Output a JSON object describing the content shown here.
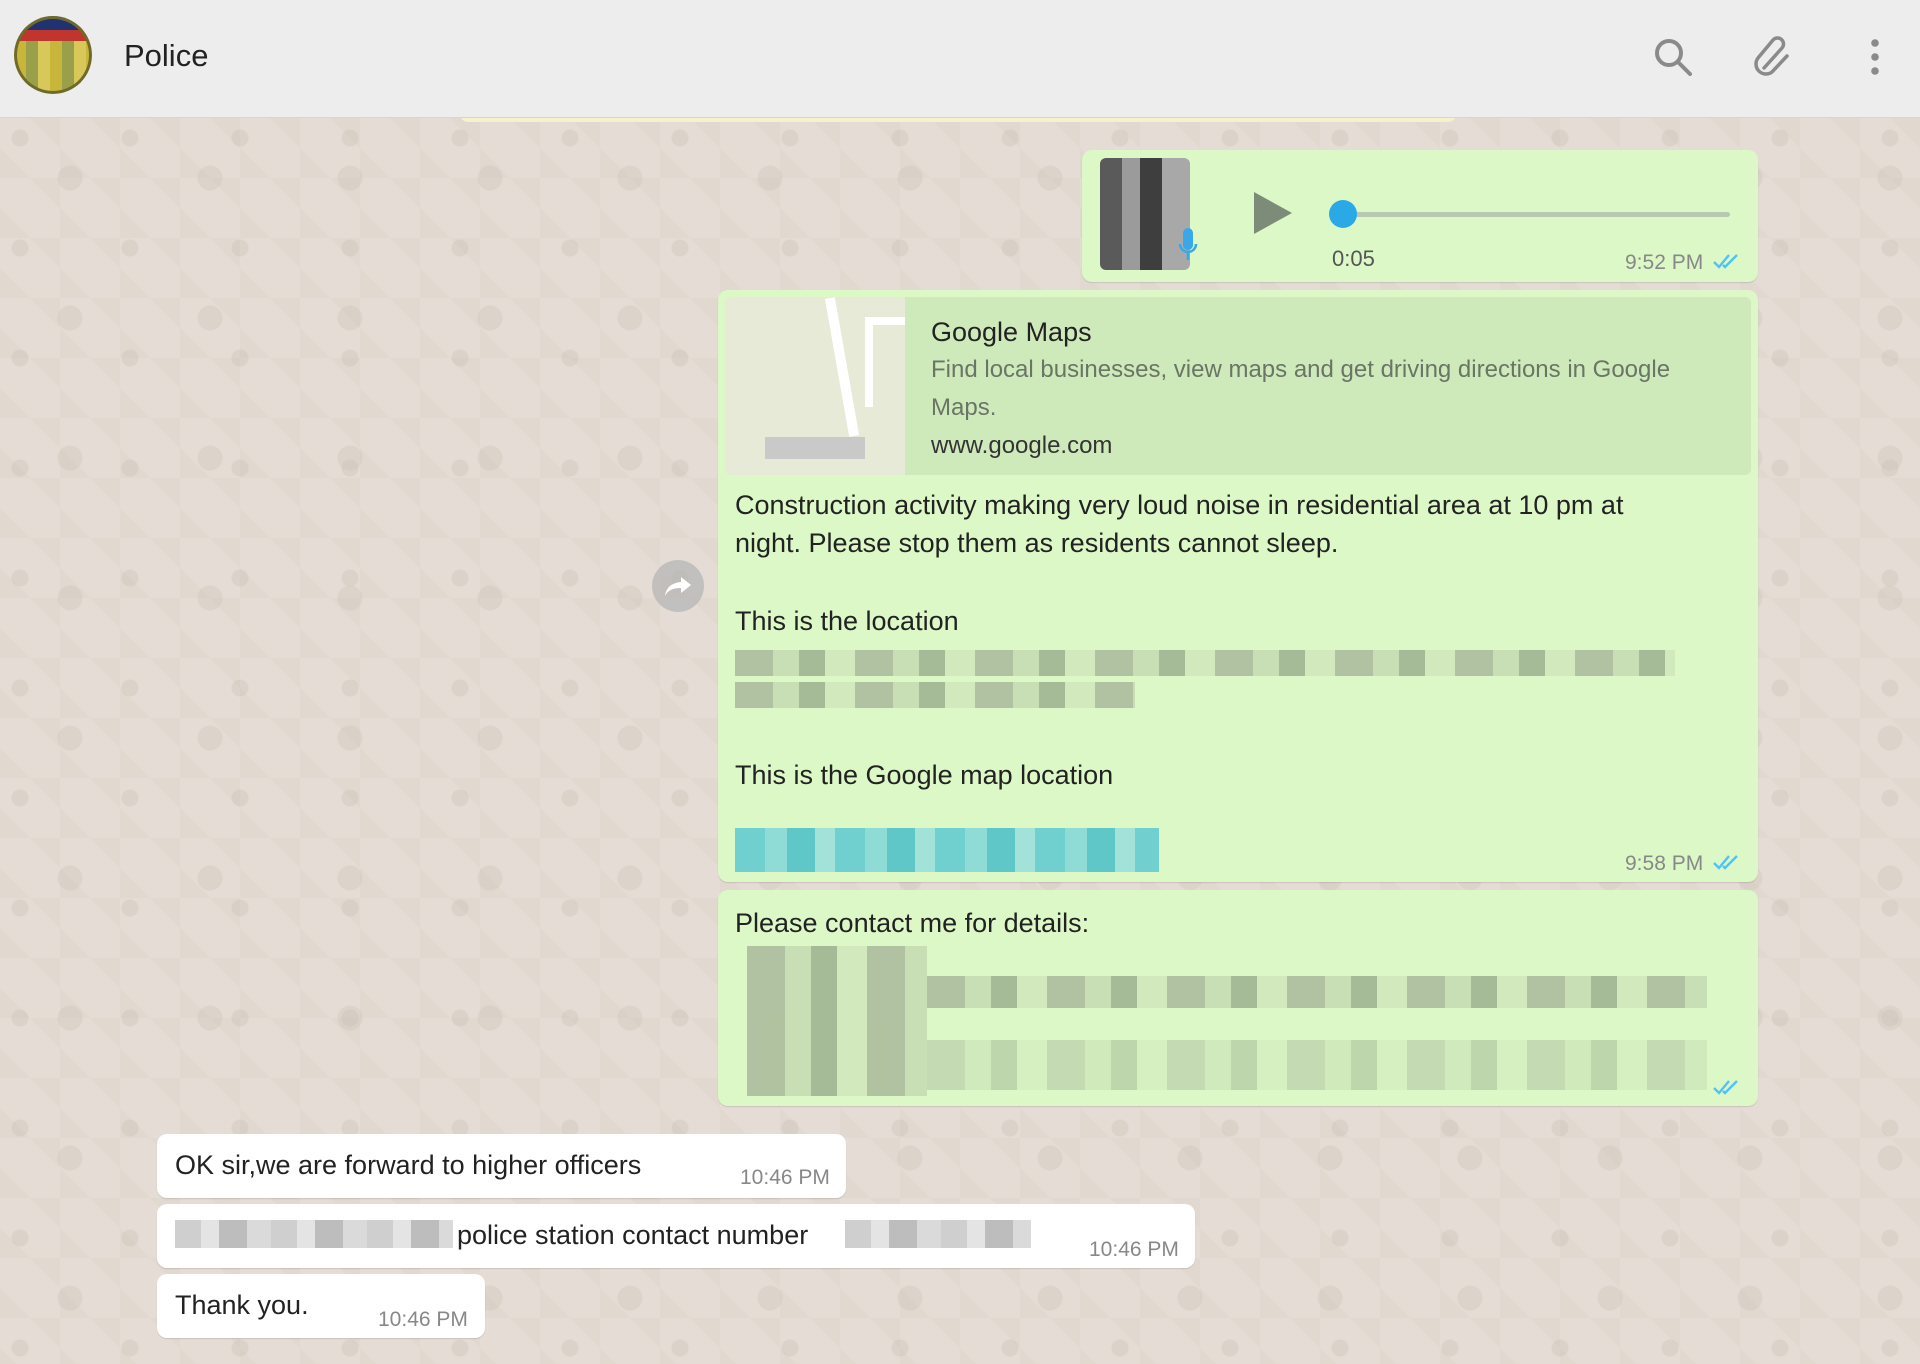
{
  "header": {
    "contact_name": "Police",
    "icons": [
      "search-icon",
      "attach-icon",
      "menu-icon"
    ]
  },
  "messages": {
    "voice": {
      "duration": "0:05",
      "time": "9:52 PM",
      "progress": 0
    },
    "maps": {
      "preview_title": "Google Maps",
      "preview_desc_1": "Find local businesses, view maps and get driving directions in Google",
      "preview_desc_2": "Maps.",
      "preview_domain": "www.google.com",
      "body_line_1": "Construction activity making very loud noise in residential area at 10 pm at",
      "body_line_2": "night. Please stop them as residents cannot sleep.",
      "location_label": "This is the location",
      "map_location_label": "This is the Google map location",
      "time": "9:58 PM"
    },
    "contact": {
      "text": "Please contact me for details:"
    },
    "reply_1": {
      "text": "OK sir,we are forward to higher officers",
      "time": "10:46 PM"
    },
    "reply_2": {
      "text": "police station contact number",
      "time": "10:46 PM"
    },
    "reply_3": {
      "text": "Thank you.",
      "time": "10:46 PM"
    }
  },
  "colors": {
    "outgoing_bubble": "#dcf8c6",
    "incoming_bubble": "#ffffff",
    "read_ticks": "#4fc3f7",
    "header_bg": "#ededed",
    "chat_bg": "#e5ddd5"
  }
}
